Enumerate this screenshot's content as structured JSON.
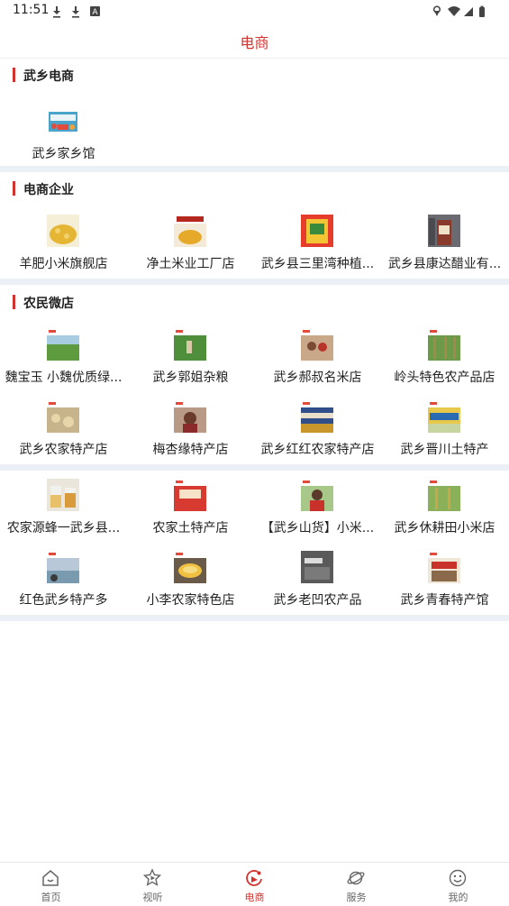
{
  "status_bar": {
    "time": "11:51"
  },
  "header": {
    "title": "电商"
  },
  "sections": [
    {
      "title": "武乡电商",
      "items": [
        {
          "label": "武乡家乡馆"
        }
      ]
    },
    {
      "title": "电商企业",
      "items": [
        {
          "label": "羊肥小米旗舰店"
        },
        {
          "label": "净土米业工厂店"
        },
        {
          "label": "武乡县三里湾种植..."
        },
        {
          "label": "武乡县康达醋业有..."
        }
      ]
    },
    {
      "title": "农民微店",
      "items": [
        {
          "label": "魏宝玉 小魏优质绿..."
        },
        {
          "label": "武乡郭姐杂粮"
        },
        {
          "label": "武乡郝叔名米店"
        },
        {
          "label": "岭头特色农产品店"
        },
        {
          "label": "武乡农家特产店"
        },
        {
          "label": "梅杏缘特产店"
        },
        {
          "label": "武乡红红农家特产店"
        },
        {
          "label": "武乡晋川土特产"
        }
      ]
    },
    {
      "title": "",
      "items": [
        {
          "label": "农家源蜂一武乡县..."
        },
        {
          "label": "农家土特产店"
        },
        {
          "label": "【武乡山货】小米..."
        },
        {
          "label": "武乡休耕田小米店"
        },
        {
          "label": "红色武乡特产多"
        },
        {
          "label": "小李农家特色店"
        },
        {
          "label": "武乡老凹农产品"
        },
        {
          "label": "武乡青春特产馆"
        }
      ]
    }
  ],
  "tabbar": [
    {
      "label": "首页",
      "icon": "home-icon"
    },
    {
      "label": "视听",
      "icon": "play-icon"
    },
    {
      "label": "电商",
      "icon": "shop-icon",
      "active": true
    },
    {
      "label": "服务",
      "icon": "planet-icon"
    },
    {
      "label": "我的",
      "icon": "smiley-icon"
    }
  ],
  "colors": {
    "accent": "#d1332f",
    "divider": "#eaf0f6",
    "tab_inactive": "#666666"
  }
}
